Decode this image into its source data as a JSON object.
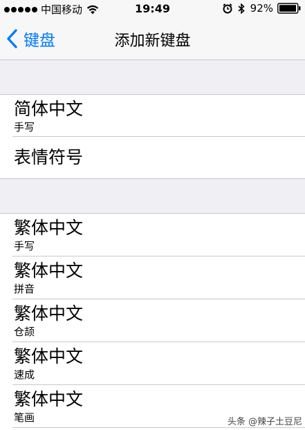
{
  "status_bar": {
    "carrier": "中国移动",
    "time": "19:49",
    "battery_percent": "92%",
    "signal_bars": 5,
    "icons": [
      "wifi-icon",
      "alarm-icon",
      "bluetooth-icon",
      "battery-icon"
    ]
  },
  "nav": {
    "back_label": "键盘",
    "title": "添加新键盘",
    "accent_color": "#007aff"
  },
  "sections": [
    {
      "items": [
        {
          "title": "简体中文",
          "subtitle": "手写"
        },
        {
          "title": "表情符号",
          "subtitle": ""
        }
      ]
    },
    {
      "items": [
        {
          "title": "繁体中文",
          "subtitle": "手写"
        },
        {
          "title": "繁体中文",
          "subtitle": "拼音"
        },
        {
          "title": "繁体中文",
          "subtitle": "仓颉"
        },
        {
          "title": "繁体中文",
          "subtitle": "速成"
        },
        {
          "title": "繁体中文",
          "subtitle": "笔画"
        }
      ]
    }
  ],
  "watermark": "头条 @辣子土豆尼"
}
